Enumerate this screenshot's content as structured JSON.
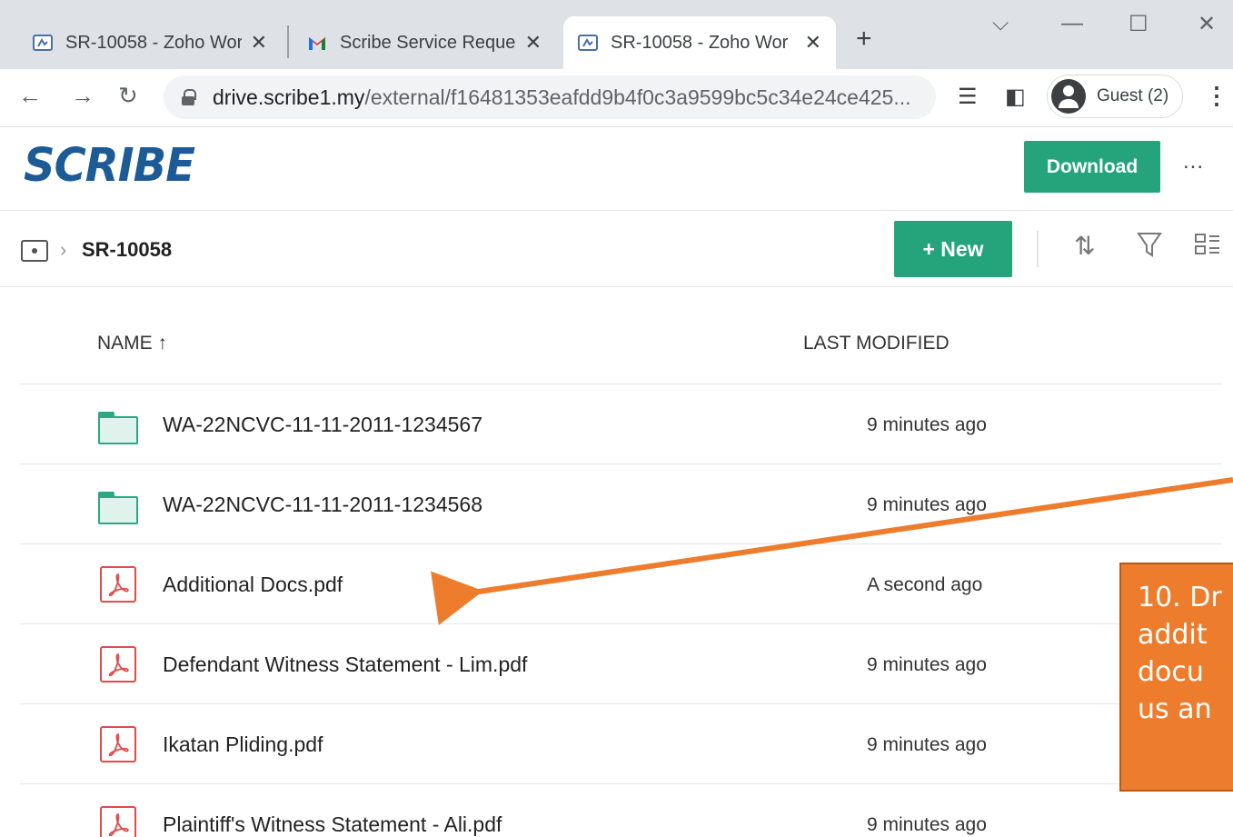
{
  "browser": {
    "tabs": [
      {
        "title": "SR-10058 - Zoho Wor",
        "icon": "zoho-workdrive-icon",
        "active": false
      },
      {
        "title": "Scribe Service Reques",
        "icon": "gmail-icon",
        "active": false
      },
      {
        "title": "SR-10058 - Zoho Wor",
        "icon": "zoho-workdrive-icon",
        "active": true
      }
    ],
    "url_host": "drive.scribe1.my",
    "url_path": "/external/f16481353eafdd9b4f0c3a9599bc5c34e24ce425...",
    "profile_label": "Guest (2)"
  },
  "app": {
    "logo_text": "SCRIBE",
    "download_label": "Download",
    "more_label": "...",
    "new_label": "+ New",
    "accent_color": "#25a47b",
    "logo_color": "#1d5b97"
  },
  "breadcrumb": {
    "current": "SR-10058"
  },
  "table": {
    "col_name": "NAME",
    "col_modified": "LAST MODIFIED",
    "sort_indicator": "↑",
    "rows": [
      {
        "type": "folder",
        "name": "WA-22NCVC-11-11-2011-1234567",
        "modified": "9 minutes ago"
      },
      {
        "type": "folder",
        "name": "WA-22NCVC-11-11-2011-1234568",
        "modified": "9 minutes ago"
      },
      {
        "type": "pdf",
        "name": "Additional Docs.pdf",
        "modified": "A second ago"
      },
      {
        "type": "pdf",
        "name": "Defendant Witness Statement - Lim.pdf",
        "modified": "9 minutes ago"
      },
      {
        "type": "pdf",
        "name": "Ikatan Pliding.pdf",
        "modified": "9 minutes ago"
      },
      {
        "type": "pdf",
        "name": "Plaintiff's Witness Statement - Ali.pdf",
        "modified": "9 minutes ago"
      }
    ]
  },
  "annotation": {
    "text": "10. Dr\naddit\ndocu\nus an",
    "color": "#ee7c2d"
  }
}
